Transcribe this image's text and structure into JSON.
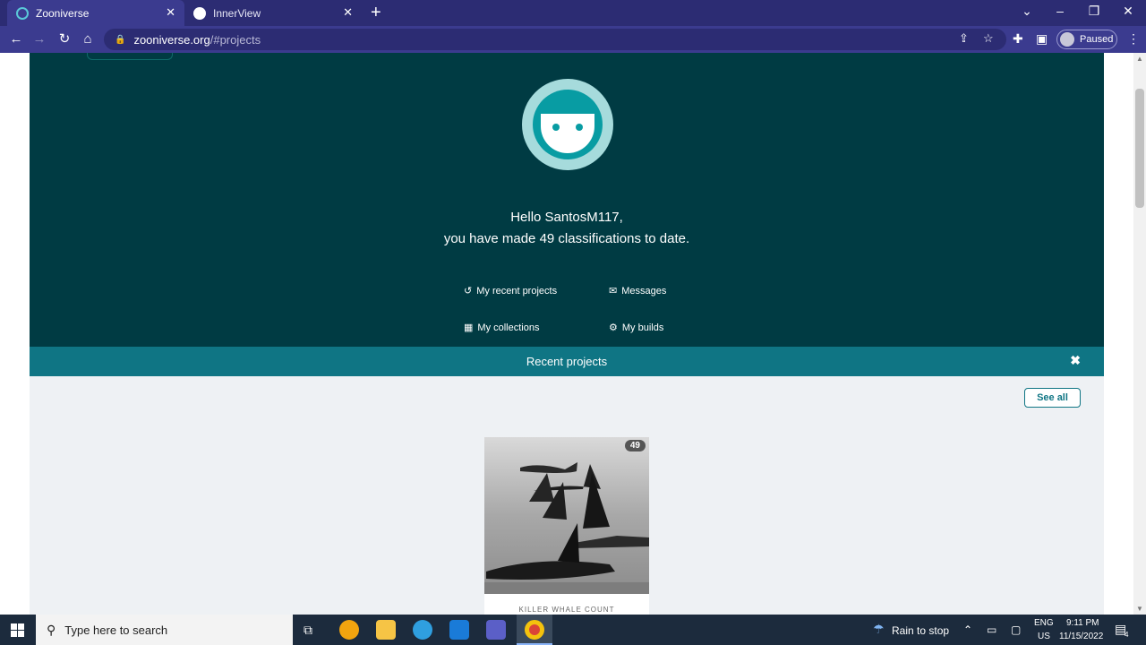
{
  "browser": {
    "tabs": [
      {
        "title": "Zooniverse",
        "active": true
      },
      {
        "title": "InnerView",
        "active": false
      }
    ],
    "url_host": "zooniverse.org",
    "url_path": "/#projects",
    "profile_status": "Paused"
  },
  "hero": {
    "greeting": "Hello SantosM117,",
    "summary": "you have made 49 classifications to date.",
    "links": {
      "recent_projects": "My recent projects",
      "messages": "Messages",
      "collections": "My collections",
      "builds": "My builds"
    }
  },
  "recent_projects": {
    "title": "Recent projects",
    "see_all": "See all",
    "cards": [
      {
        "title": "KILLER WHALE COUNT",
        "count": "49"
      }
    ]
  },
  "taskbar": {
    "search_placeholder": "Type here to search",
    "weather": "Rain to stop",
    "lang_top": "ENG",
    "lang_bottom": "US",
    "time": "9:11 PM",
    "date": "11/15/2022",
    "notifications": "4"
  }
}
